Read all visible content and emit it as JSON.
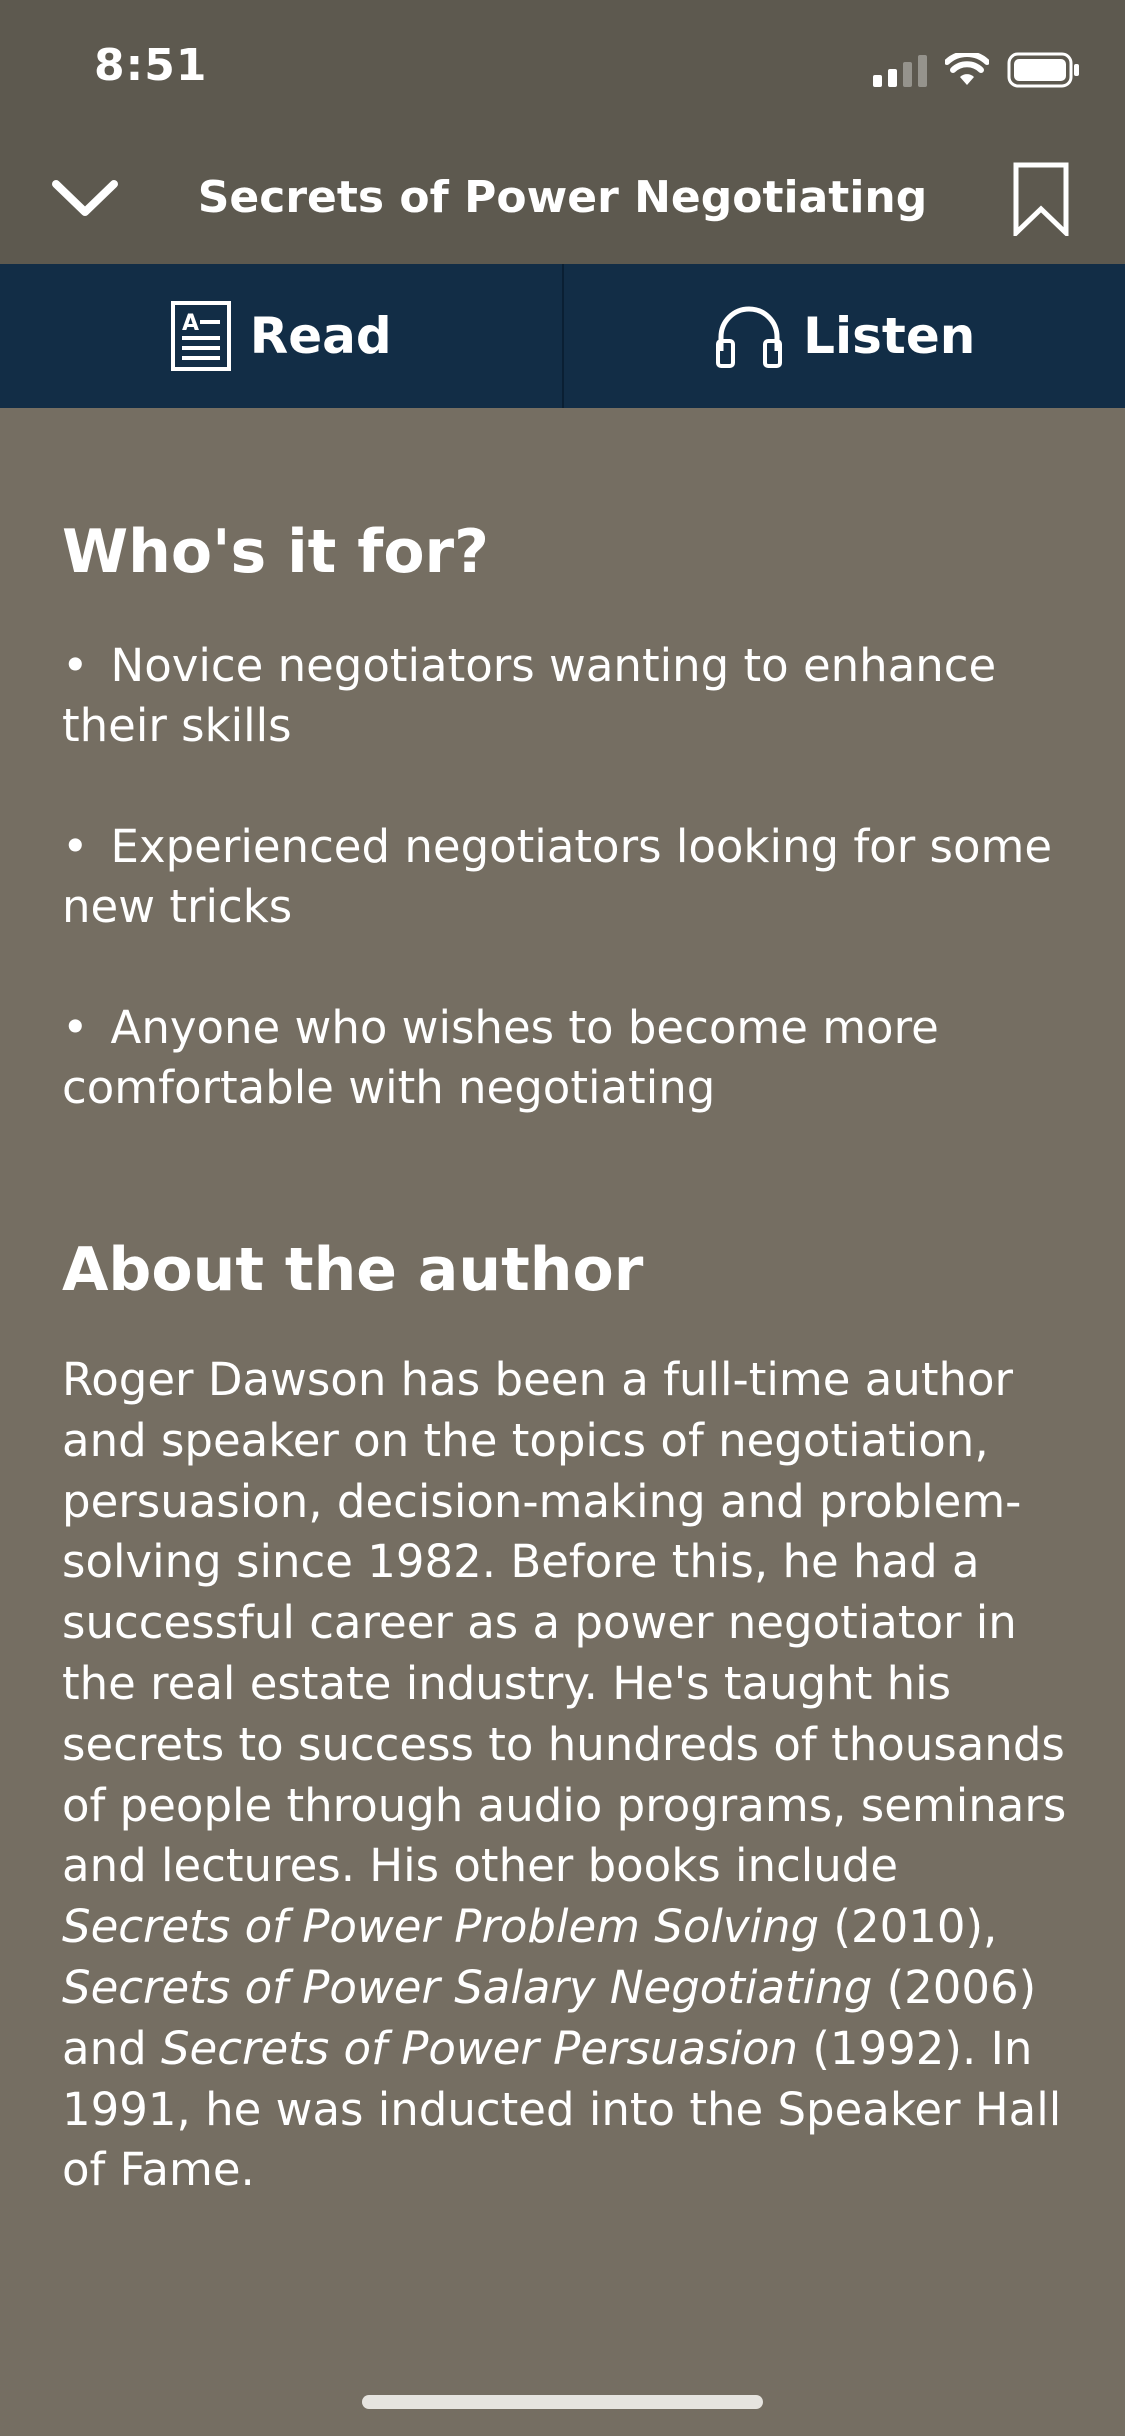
{
  "status_bar": {
    "time": "8:51"
  },
  "nav": {
    "title": "Secrets of Power Negotiating"
  },
  "tabs": [
    {
      "label": "Read",
      "icon": "document-icon"
    },
    {
      "label": "Listen",
      "icon": "headphones-icon"
    }
  ],
  "whos_it_for": {
    "heading": "Who's it for?",
    "items": [
      "Novice negotiators wanting to enhance their skills",
      "Experienced negotiators looking for some new tricks",
      "Anyone who wishes to become more comfortable with negotiating"
    ]
  },
  "about": {
    "heading": "About the author",
    "text_1": "Roger Dawson has been a full-time author and speaker on the topics of negotiation, persuasion, decision-making and problem-solving since 1982. Before this, he had a successful career as a power negotiator in the real estate industry. He's taught his secrets to success to hundreds of thousands of people through audio programs, seminars and lectures. His other books include ",
    "book_1": "Secrets of Power Problem Solving",
    "text_2": " (2010), ",
    "book_2": "Secrets of Power Salary Negotiating",
    "text_3": " (2006) and ",
    "book_3": "Secrets of Power Persuasion",
    "text_4": " (1992). In 1991, he was inducted into the Speaker Hall of Fame."
  },
  "colors": {
    "background": "#756e62",
    "header": "#5d594f",
    "tab_bar": "#122d46"
  }
}
